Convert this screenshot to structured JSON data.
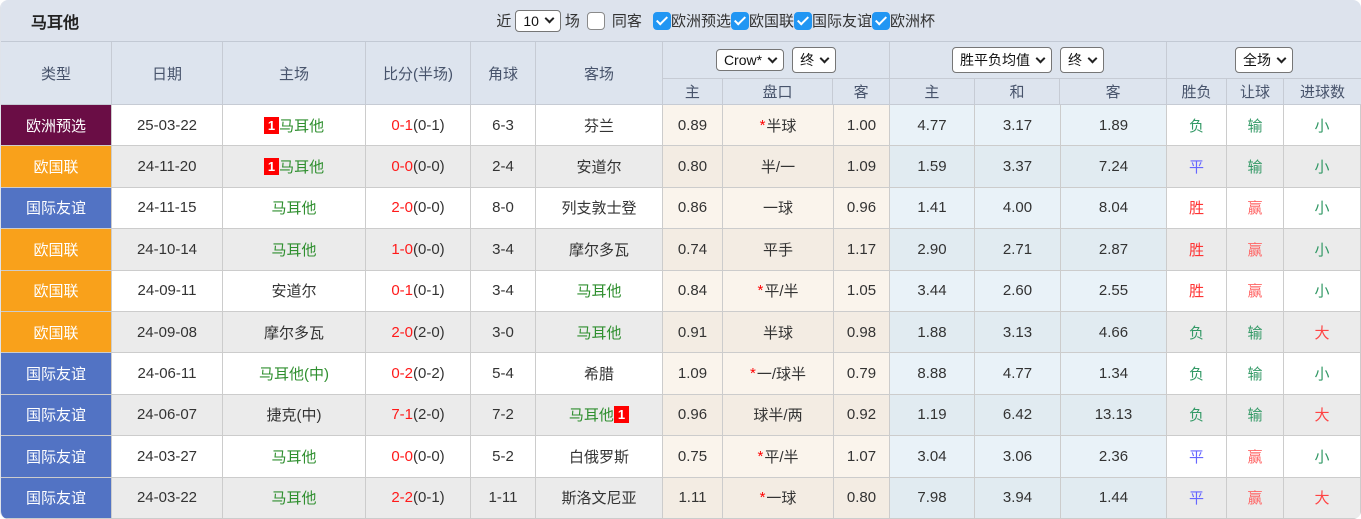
{
  "topbar": {
    "title": "马耳他",
    "near_label": "近",
    "matches_value": "10",
    "matches_label": "场",
    "same_away": {
      "label": "同客",
      "checked": false
    },
    "league_filters": [
      {
        "label": "欧洲预选",
        "checked": true
      },
      {
        "label": "欧国联",
        "checked": true
      },
      {
        "label": "国际友谊",
        "checked": true
      },
      {
        "label": "欧洲杯",
        "checked": true
      }
    ]
  },
  "header": {
    "static_cols": [
      "类型",
      "日期",
      "主场",
      "比分(半场)",
      "角球",
      "客场"
    ],
    "group_odds": {
      "select_company": "Crow*",
      "select_stage": "终",
      "cols": [
        "主",
        "盘口",
        "客"
      ]
    },
    "group_avg": {
      "select_name": "胜平负均值",
      "select_stage": "终",
      "cols": [
        "主",
        "和",
        "客"
      ]
    },
    "group_result": {
      "select_scope": "全场",
      "cols": [
        "胜负",
        "让球",
        "进球数"
      ]
    }
  },
  "league_colors": {
    "欧洲预选": "#6a0d45",
    "欧国联": "#f9a11b",
    "国际友谊": "#5273c4"
  },
  "result_colors": {
    "胜": "#ff3333",
    "平": "#6666ff",
    "负": "#339966",
    "赢": "#ff6666",
    "输": "#339966",
    "大": "#ff4444",
    "小": "#339966"
  },
  "rows": [
    {
      "league": "欧洲预选",
      "date": "25-03-22",
      "home": "马耳他",
      "home_badge": "1",
      "home_self": true,
      "score_ft": "0-1",
      "score_ht": "(0-1)",
      "corner": "6-3",
      "away": "芬兰",
      "away_badge": "",
      "away_self": false,
      "odds_home": "0.89",
      "pan_star": "*",
      "pan": "半球",
      "odds_away": "1.00",
      "avg_win": "4.77",
      "avg_draw": "3.17",
      "avg_lose": "1.89",
      "res_wdl": "负",
      "res_handicap": "输",
      "res_goals": "小"
    },
    {
      "league": "欧国联",
      "date": "24-11-20",
      "home": "马耳他",
      "home_badge": "1",
      "home_self": true,
      "score_ft": "0-0",
      "score_ht": "(0-0)",
      "corner": "2-4",
      "away": "安道尔",
      "away_badge": "",
      "away_self": false,
      "odds_home": "0.80",
      "pan_star": "",
      "pan": "半/一",
      "odds_away": "1.09",
      "avg_win": "1.59",
      "avg_draw": "3.37",
      "avg_lose": "7.24",
      "res_wdl": "平",
      "res_handicap": "输",
      "res_goals": "小"
    },
    {
      "league": "国际友谊",
      "date": "24-11-15",
      "home": "马耳他",
      "home_badge": "",
      "home_self": true,
      "score_ft": "2-0",
      "score_ht": "(0-0)",
      "corner": "8-0",
      "away": "列支敦士登",
      "away_badge": "",
      "away_self": false,
      "odds_home": "0.86",
      "pan_star": "",
      "pan": "一球",
      "odds_away": "0.96",
      "avg_win": "1.41",
      "avg_draw": "4.00",
      "avg_lose": "8.04",
      "res_wdl": "胜",
      "res_handicap": "赢",
      "res_goals": "小"
    },
    {
      "league": "欧国联",
      "date": "24-10-14",
      "home": "马耳他",
      "home_badge": "",
      "home_self": true,
      "score_ft": "1-0",
      "score_ht": "(0-0)",
      "corner": "3-4",
      "away": "摩尔多瓦",
      "away_badge": "",
      "away_self": false,
      "odds_home": "0.74",
      "pan_star": "",
      "pan": "平手",
      "odds_away": "1.17",
      "avg_win": "2.90",
      "avg_draw": "2.71",
      "avg_lose": "2.87",
      "res_wdl": "胜",
      "res_handicap": "赢",
      "res_goals": "小"
    },
    {
      "league": "欧国联",
      "date": "24-09-11",
      "home": "安道尔",
      "home_badge": "",
      "home_self": false,
      "score_ft": "0-1",
      "score_ht": "(0-1)",
      "corner": "3-4",
      "away": "马耳他",
      "away_badge": "",
      "away_self": true,
      "odds_home": "0.84",
      "pan_star": "*",
      "pan": "平/半",
      "odds_away": "1.05",
      "avg_win": "3.44",
      "avg_draw": "2.60",
      "avg_lose": "2.55",
      "res_wdl": "胜",
      "res_handicap": "赢",
      "res_goals": "小"
    },
    {
      "league": "欧国联",
      "date": "24-09-08",
      "home": "摩尔多瓦",
      "home_badge": "",
      "home_self": false,
      "score_ft": "2-0",
      "score_ht": "(2-0)",
      "corner": "3-0",
      "away": "马耳他",
      "away_badge": "",
      "away_self": true,
      "odds_home": "0.91",
      "pan_star": "",
      "pan": "半球",
      "odds_away": "0.98",
      "avg_win": "1.88",
      "avg_draw": "3.13",
      "avg_lose": "4.66",
      "res_wdl": "负",
      "res_handicap": "输",
      "res_goals": "大"
    },
    {
      "league": "国际友谊",
      "date": "24-06-11",
      "home": "马耳他(中)",
      "home_badge": "",
      "home_self": true,
      "score_ft": "0-2",
      "score_ht": "(0-2)",
      "corner": "5-4",
      "away": "希腊",
      "away_badge": "",
      "away_self": false,
      "odds_home": "1.09",
      "pan_star": "*",
      "pan": "一/球半",
      "odds_away": "0.79",
      "avg_win": "8.88",
      "avg_draw": "4.77",
      "avg_lose": "1.34",
      "res_wdl": "负",
      "res_handicap": "输",
      "res_goals": "小"
    },
    {
      "league": "国际友谊",
      "date": "24-06-07",
      "home": "捷克(中)",
      "home_badge": "",
      "home_self": false,
      "score_ft": "7-1",
      "score_ht": "(2-0)",
      "corner": "7-2",
      "away": "马耳他",
      "away_badge": "1",
      "away_self": true,
      "odds_home": "0.96",
      "pan_star": "",
      "pan": "球半/两",
      "odds_away": "0.92",
      "avg_win": "1.19",
      "avg_draw": "6.42",
      "avg_lose": "13.13",
      "res_wdl": "负",
      "res_handicap": "输",
      "res_goals": "大"
    },
    {
      "league": "国际友谊",
      "date": "24-03-27",
      "home": "马耳他",
      "home_badge": "",
      "home_self": true,
      "score_ft": "0-0",
      "score_ht": "(0-0)",
      "corner": "5-2",
      "away": "白俄罗斯",
      "away_badge": "",
      "away_self": false,
      "odds_home": "0.75",
      "pan_star": "*",
      "pan": "平/半",
      "odds_away": "1.07",
      "avg_win": "3.04",
      "avg_draw": "3.06",
      "avg_lose": "2.36",
      "res_wdl": "平",
      "res_handicap": "赢",
      "res_goals": "小"
    },
    {
      "league": "国际友谊",
      "date": "24-03-22",
      "home": "马耳他",
      "home_badge": "",
      "home_self": true,
      "score_ft": "2-2",
      "score_ht": "(0-1)",
      "corner": "1-11",
      "away": "斯洛文尼亚",
      "away_badge": "",
      "away_self": false,
      "odds_home": "1.11",
      "pan_star": "*",
      "pan": "一球",
      "odds_away": "0.80",
      "avg_win": "7.98",
      "avg_draw": "3.94",
      "avg_lose": "1.44",
      "res_wdl": "平",
      "res_handicap": "赢",
      "res_goals": "大"
    }
  ]
}
